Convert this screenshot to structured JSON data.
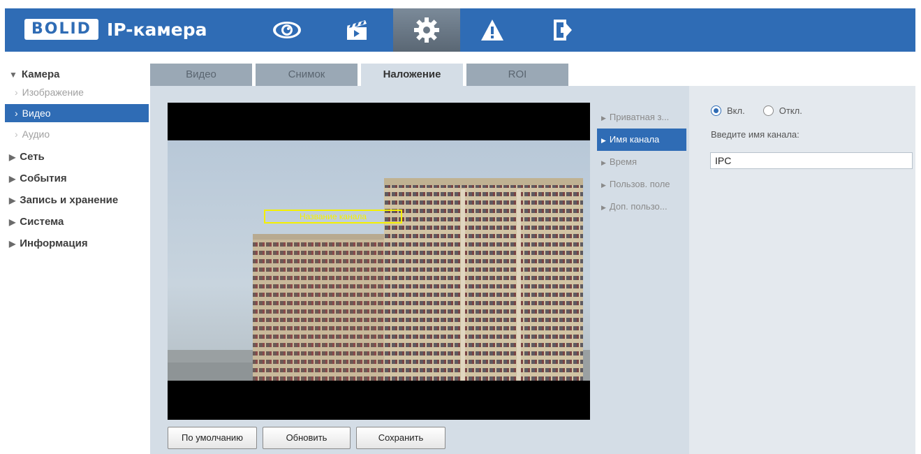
{
  "header": {
    "logo_mark": "BOLID",
    "title": "IP-камера",
    "nav_icons": [
      "eye-icon",
      "clapperboard-icon",
      "gear-icon",
      "warning-icon",
      "logout-icon"
    ],
    "active_icon": "gear-icon",
    "bar_color": "#2f6cb5"
  },
  "sidebar": {
    "sections": [
      {
        "label": "Камера",
        "expanded": true
      },
      {
        "label": "Сеть"
      },
      {
        "label": "События"
      },
      {
        "label": "Запись и хранение"
      },
      {
        "label": "Система"
      },
      {
        "label": "Информация"
      }
    ],
    "camera_items": [
      {
        "label": "Изображение"
      },
      {
        "label": "Видео",
        "active": true
      },
      {
        "label": "Аудио"
      }
    ]
  },
  "tabs": [
    {
      "label": "Видео"
    },
    {
      "label": "Снимок"
    },
    {
      "label": "Наложение",
      "active": true
    },
    {
      "label": "ROI"
    }
  ],
  "video": {
    "overlay_label": "Название канала"
  },
  "overlay_menu": [
    {
      "label": "Приватная з..."
    },
    {
      "label": "Имя канала",
      "active": true
    },
    {
      "label": "Время"
    },
    {
      "label": "Пользов. поле"
    },
    {
      "label": "Доп. пользо..."
    }
  ],
  "settings": {
    "radio_on": "Вкл.",
    "radio_off": "Откл.",
    "selected": "Вкл.",
    "name_label": "Введите имя канала:",
    "name_value": "IPC"
  },
  "buttons": {
    "default_label": "По умолчанию",
    "refresh_label": "Обновить",
    "save_label": "Сохранить"
  }
}
